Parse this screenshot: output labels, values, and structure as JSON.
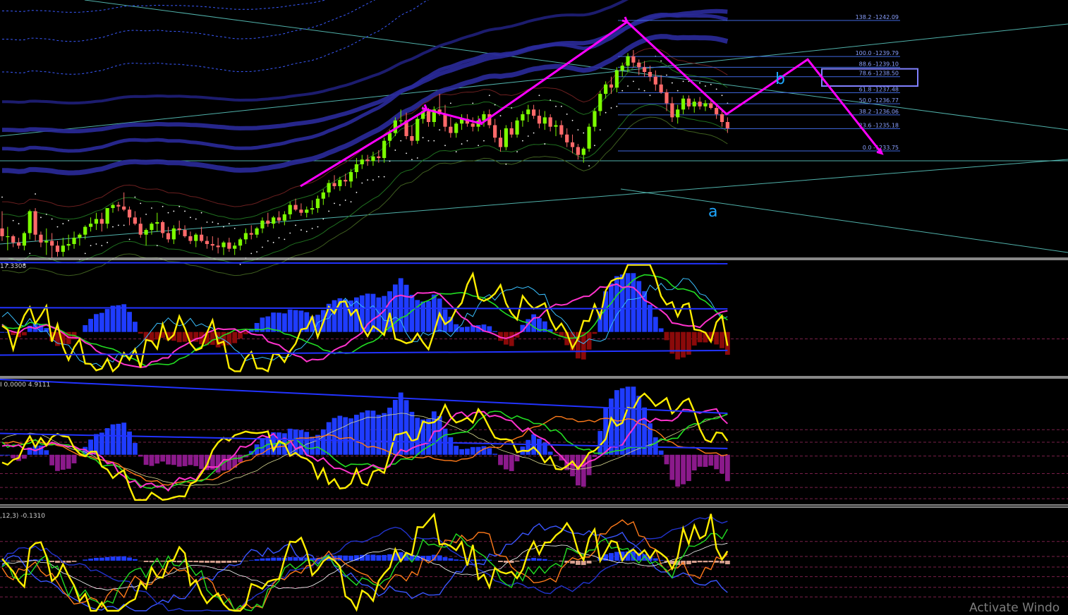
{
  "watermark": "Activate Windo",
  "colors": {
    "bg": "#000000",
    "bull": "#7cfc00",
    "bear": "#ff6a6a",
    "wave": "#ff00ff",
    "fibo": "#4169e1",
    "trend": "#5fd0c8",
    "hist_up": "#1f3cff",
    "hist_dn_1": "#8b0a0a",
    "hist_dn_2": "#8b1a8b",
    "yellow": "#ffee00",
    "green": "#22dd22",
    "magenta": "#ff33cc",
    "orange": "#ff7a1a",
    "blue_line": "#2233ff",
    "cyan": "#3ac0ff",
    "label_text": "#cfcfcf"
  },
  "chart_data": [
    {
      "type": "candlestick",
      "panel": "price",
      "wave_labels": [
        "a",
        "b"
      ],
      "fibo_levels": [
        {
          "label": "138.2 -1242.09",
          "value": 1242.09
        },
        {
          "label": "100.0 -1239.79",
          "value": 1239.79
        },
        {
          "label": "88.6 -1239.10",
          "value": 1239.1
        },
        {
          "label": "78.6 -1238.50",
          "value": 1238.5
        },
        {
          "label": "61.8 -1237.48",
          "value": 1237.48
        },
        {
          "label": "50.0 -1236.77",
          "value": 1236.77
        },
        {
          "label": "38.2 -1236.06",
          "value": 1236.06
        },
        {
          "label": "23.6 -1235.18",
          "value": 1235.18
        },
        {
          "label": "0.0 -1233.75",
          "value": 1233.75
        }
      ],
      "ylim": [
        1226.9,
        1243.4
      ],
      "zigzag_projection": [
        1224.0,
        1230.6,
        1229.6,
        1232.1,
        1234.3,
        1242.0,
        1236.0,
        1239.3,
        1239.8,
        1233.6
      ],
      "candles": [
        [
          1228.8,
          1229.9,
          1228.0,
          1228.3
        ],
        [
          1228.3,
          1228.9,
          1227.4,
          1228.3
        ],
        [
          1228.3,
          1228.4,
          1227.6,
          1227.9
        ],
        [
          1227.9,
          1228.2,
          1227.5,
          1227.7
        ],
        [
          1227.7,
          1228.6,
          1227.4,
          1228.5
        ],
        [
          1228.5,
          1230.0,
          1228.1,
          1229.9
        ],
        [
          1229.9,
          1230.1,
          1228.0,
          1228.4
        ],
        [
          1228.4,
          1228.6,
          1227.6,
          1227.9
        ],
        [
          1227.9,
          1228.8,
          1227.1,
          1228.0
        ],
        [
          1228.0,
          1228.5,
          1226.9,
          1227.7
        ],
        [
          1227.7,
          1228.0,
          1227.0,
          1227.3
        ],
        [
          1227.3,
          1228.2,
          1227.0,
          1227.7
        ],
        [
          1227.7,
          1228.4,
          1227.4,
          1227.8
        ],
        [
          1227.8,
          1228.6,
          1227.5,
          1228.2
        ],
        [
          1228.2,
          1228.5,
          1227.7,
          1228.4
        ],
        [
          1228.4,
          1229.0,
          1228.1,
          1228.9
        ],
        [
          1228.9,
          1229.5,
          1228.6,
          1229.1
        ],
        [
          1229.1,
          1229.8,
          1228.7,
          1229.4
        ],
        [
          1229.4,
          1229.8,
          1228.6,
          1229.1
        ],
        [
          1229.1,
          1230.1,
          1228.8,
          1230.1
        ],
        [
          1230.1,
          1230.4,
          1229.8,
          1230.3
        ],
        [
          1230.3,
          1230.5,
          1229.9,
          1230.2
        ],
        [
          1230.2,
          1231.1,
          1229.9,
          1230.0
        ],
        [
          1230.0,
          1230.2,
          1229.0,
          1229.5
        ],
        [
          1229.5,
          1229.9,
          1229.0,
          1229.1
        ],
        [
          1229.1,
          1229.5,
          1228.2,
          1228.4
        ],
        [
          1228.4,
          1228.8,
          1227.7,
          1228.7
        ],
        [
          1228.7,
          1229.2,
          1228.4,
          1229.1
        ],
        [
          1229.1,
          1229.8,
          1228.6,
          1229.2
        ],
        [
          1229.2,
          1229.3,
          1228.2,
          1228.5
        ],
        [
          1228.5,
          1228.9,
          1227.9,
          1228.1
        ],
        [
          1228.1,
          1229.0,
          1227.8,
          1228.8
        ],
        [
          1228.8,
          1229.3,
          1228.4,
          1228.7
        ],
        [
          1228.7,
          1229.0,
          1228.2,
          1228.3
        ],
        [
          1228.3,
          1228.6,
          1227.8,
          1228.0
        ],
        [
          1228.0,
          1228.5,
          1227.6,
          1228.4
        ],
        [
          1228.4,
          1228.9,
          1227.9,
          1228.0
        ],
        [
          1228.0,
          1228.3,
          1227.5,
          1227.8
        ],
        [
          1227.8,
          1228.3,
          1227.4,
          1227.7
        ],
        [
          1227.7,
          1228.2,
          1227.2,
          1227.6
        ],
        [
          1227.6,
          1228.0,
          1227.1,
          1227.9
        ],
        [
          1227.9,
          1228.2,
          1227.3,
          1227.5
        ],
        [
          1227.5,
          1227.9,
          1227.1,
          1227.7
        ],
        [
          1227.7,
          1228.2,
          1227.4,
          1228.1
        ],
        [
          1228.1,
          1228.8,
          1227.8,
          1228.5
        ],
        [
          1228.5,
          1229.0,
          1228.1,
          1228.4
        ],
        [
          1228.4,
          1228.9,
          1228.2,
          1228.8
        ],
        [
          1228.8,
          1229.5,
          1228.5,
          1229.3
        ],
        [
          1229.3,
          1229.8,
          1228.9,
          1229.1
        ],
        [
          1229.1,
          1229.6,
          1228.8,
          1229.5
        ],
        [
          1229.5,
          1229.9,
          1229.1,
          1229.3
        ],
        [
          1229.3,
          1229.9,
          1229.0,
          1229.7
        ],
        [
          1229.7,
          1230.5,
          1229.4,
          1230.3
        ],
        [
          1230.3,
          1230.7,
          1229.9,
          1230.0
        ],
        [
          1230.0,
          1230.4,
          1229.6,
          1229.8
        ],
        [
          1229.8,
          1230.2,
          1229.5,
          1230.0
        ],
        [
          1230.0,
          1230.6,
          1229.7,
          1230.1
        ],
        [
          1230.1,
          1230.9,
          1229.8,
          1230.7
        ],
        [
          1230.7,
          1231.3,
          1230.3,
          1231.1
        ],
        [
          1231.1,
          1231.9,
          1230.8,
          1231.7
        ],
        [
          1231.7,
          1232.2,
          1231.3,
          1231.5
        ],
        [
          1231.5,
          1232.1,
          1231.2,
          1231.9
        ],
        [
          1231.9,
          1232.3,
          1231.5,
          1231.8
        ],
        [
          1231.8,
          1232.6,
          1231.4,
          1232.4
        ],
        [
          1232.4,
          1233.3,
          1232.0,
          1232.9
        ],
        [
          1232.9,
          1233.5,
          1232.6,
          1233.2
        ],
        [
          1233.2,
          1233.5,
          1232.8,
          1233.1
        ],
        [
          1233.1,
          1233.7,
          1232.8,
          1233.4
        ],
        [
          1233.4,
          1233.8,
          1233.0,
          1233.3
        ],
        [
          1233.3,
          1234.6,
          1233.0,
          1234.4
        ],
        [
          1234.4,
          1235.1,
          1234.0,
          1234.9
        ],
        [
          1234.9,
          1235.9,
          1234.7,
          1235.7
        ],
        [
          1235.7,
          1236.4,
          1235.3,
          1235.7
        ],
        [
          1235.7,
          1236.2,
          1234.5,
          1234.7
        ],
        [
          1234.7,
          1235.4,
          1234.1,
          1234.4
        ],
        [
          1234.4,
          1236.0,
          1234.2,
          1235.8
        ],
        [
          1235.8,
          1236.6,
          1235.5,
          1236.3
        ],
        [
          1236.3,
          1236.5,
          1235.3,
          1235.6
        ],
        [
          1235.6,
          1236.6,
          1235.3,
          1236.4
        ],
        [
          1236.4,
          1237.4,
          1236.0,
          1236.1
        ],
        [
          1236.1,
          1236.7,
          1235.0,
          1235.3
        ],
        [
          1235.3,
          1235.9,
          1234.6,
          1234.9
        ],
        [
          1234.9,
          1235.6,
          1234.6,
          1235.5
        ],
        [
          1235.5,
          1236.1,
          1235.1,
          1235.8
        ],
        [
          1235.8,
          1236.1,
          1235.3,
          1235.5
        ],
        [
          1235.5,
          1235.9,
          1235.0,
          1235.3
        ],
        [
          1235.3,
          1236.0,
          1235.0,
          1235.7
        ],
        [
          1235.7,
          1236.3,
          1235.3,
          1236.1
        ],
        [
          1236.1,
          1236.4,
          1235.2,
          1235.4
        ],
        [
          1235.4,
          1235.8,
          1234.3,
          1234.6
        ],
        [
          1234.6,
          1235.1,
          1233.7,
          1234.0
        ],
        [
          1234.0,
          1235.4,
          1233.8,
          1235.2
        ],
        [
          1235.2,
          1235.6,
          1234.6,
          1234.8
        ],
        [
          1234.8,
          1235.9,
          1234.6,
          1235.7
        ],
        [
          1235.7,
          1236.3,
          1235.3,
          1236.1
        ],
        [
          1236.1,
          1236.7,
          1235.6,
          1236.4
        ],
        [
          1236.4,
          1236.7,
          1235.8,
          1236.0
        ],
        [
          1236.0,
          1236.4,
          1235.2,
          1235.5
        ],
        [
          1235.5,
          1236.3,
          1235.1,
          1235.9
        ],
        [
          1235.9,
          1236.1,
          1235.0,
          1235.3
        ],
        [
          1235.3,
          1235.7,
          1234.7,
          1235.4
        ],
        [
          1235.4,
          1235.7,
          1234.6,
          1234.8
        ],
        [
          1234.8,
          1235.2,
          1234.0,
          1234.3
        ],
        [
          1234.3,
          1234.8,
          1233.6,
          1234.0
        ],
        [
          1234.0,
          1234.2,
          1233.2,
          1233.5
        ],
        [
          1233.5,
          1234.0,
          1233.0,
          1233.9
        ],
        [
          1233.9,
          1235.5,
          1233.7,
          1235.3
        ],
        [
          1235.3,
          1236.5,
          1235.0,
          1236.3
        ],
        [
          1236.3,
          1237.6,
          1236.0,
          1237.4
        ],
        [
          1237.4,
          1238.2,
          1237.1,
          1238.0
        ],
        [
          1238.0,
          1238.5,
          1237.4,
          1237.8
        ],
        [
          1237.8,
          1239.1,
          1237.5,
          1238.9
        ],
        [
          1238.9,
          1239.4,
          1238.5,
          1239.2
        ],
        [
          1239.2,
          1240.0,
          1238.8,
          1239.8
        ],
        [
          1239.8,
          1240.2,
          1239.1,
          1239.4
        ],
        [
          1239.4,
          1239.6,
          1238.6,
          1239.1
        ],
        [
          1239.1,
          1239.5,
          1238.5,
          1238.8
        ],
        [
          1238.8,
          1239.2,
          1238.2,
          1238.5
        ],
        [
          1238.5,
          1238.9,
          1237.6,
          1238.0
        ],
        [
          1238.0,
          1238.6,
          1237.4,
          1237.5
        ],
        [
          1237.5,
          1237.7,
          1236.3,
          1236.8
        ],
        [
          1236.8,
          1237.2,
          1235.6,
          1235.9
        ],
        [
          1235.9,
          1236.7,
          1235.5,
          1236.4
        ],
        [
          1236.4,
          1237.3,
          1236.1,
          1237.1
        ],
        [
          1237.1,
          1237.3,
          1236.4,
          1236.6
        ],
        [
          1236.6,
          1237.1,
          1236.2,
          1236.9
        ],
        [
          1236.9,
          1237.2,
          1236.4,
          1236.6
        ],
        [
          1236.6,
          1237.0,
          1236.3,
          1236.8
        ],
        [
          1236.8,
          1237.1,
          1236.4,
          1236.5
        ],
        [
          1236.5,
          1236.8,
          1235.8,
          1236.1
        ],
        [
          1236.1,
          1236.4,
          1235.3,
          1235.6
        ],
        [
          1235.6,
          1235.9,
          1234.9,
          1235.2
        ]
      ]
    },
    {
      "type": "oscillator",
      "panel": "indicator_1",
      "label": "17.3308"
    },
    {
      "type": "oscillator",
      "panel": "indicator_2",
      "label": "I 0.0000 4.9111"
    },
    {
      "type": "oscillator",
      "panel": "indicator_3",
      "label": ",12,3) -0.1310"
    }
  ]
}
